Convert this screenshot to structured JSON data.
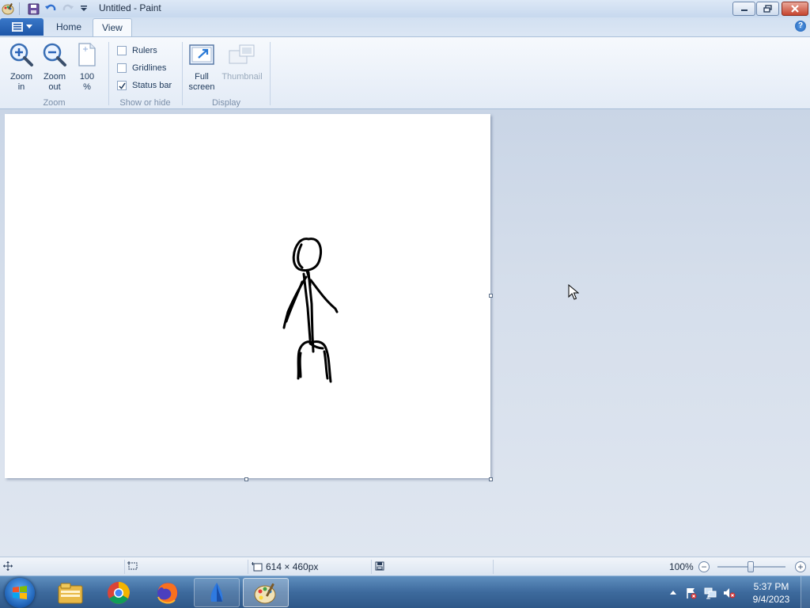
{
  "window": {
    "title": "Untitled - Paint"
  },
  "ribbon": {
    "tabs": [
      {
        "label": "Home",
        "active": false
      },
      {
        "label": "View",
        "active": true
      }
    ],
    "groups": {
      "zoom": {
        "label": "Zoom",
        "buttons": [
          {
            "label": "Zoom\nin",
            "icon": "zoom-in-icon"
          },
          {
            "label": "Zoom\nout",
            "icon": "zoom-out-icon"
          },
          {
            "label": "100\n%",
            "icon": "actual-size-icon"
          }
        ]
      },
      "show_hide": {
        "label": "Show or hide",
        "checkboxes": [
          {
            "label": "Rulers",
            "checked": false
          },
          {
            "label": "Gridlines",
            "checked": false
          },
          {
            "label": "Status bar",
            "checked": true
          }
        ]
      },
      "display": {
        "label": "Display",
        "buttons": [
          {
            "label": "Full\nscreen",
            "icon": "full-screen-icon",
            "enabled": true
          },
          {
            "label": "Thumbnail",
            "icon": "thumbnail-icon",
            "enabled": false
          }
        ]
      }
    }
  },
  "statusbar": {
    "canvas_size": "614 × 460px",
    "zoom": "100%",
    "zoom_level": 1.0
  },
  "taskbar": {
    "apps": [
      {
        "name": "windows-explorer-icon",
        "state": "pinned"
      },
      {
        "name": "chrome-icon",
        "state": "pinned"
      },
      {
        "name": "firefox-icon",
        "state": "pinned"
      },
      {
        "name": "app-icon",
        "state": "open"
      },
      {
        "name": "paint-icon",
        "state": "active"
      }
    ],
    "clock": {
      "time": "5:37 PM",
      "date": "9/4/2023"
    }
  },
  "colors": {
    "accent": "#1d56a8",
    "workspace": "#d5deeb",
    "canvas": "#ffffff",
    "taskbar": "#3d6a9d"
  }
}
